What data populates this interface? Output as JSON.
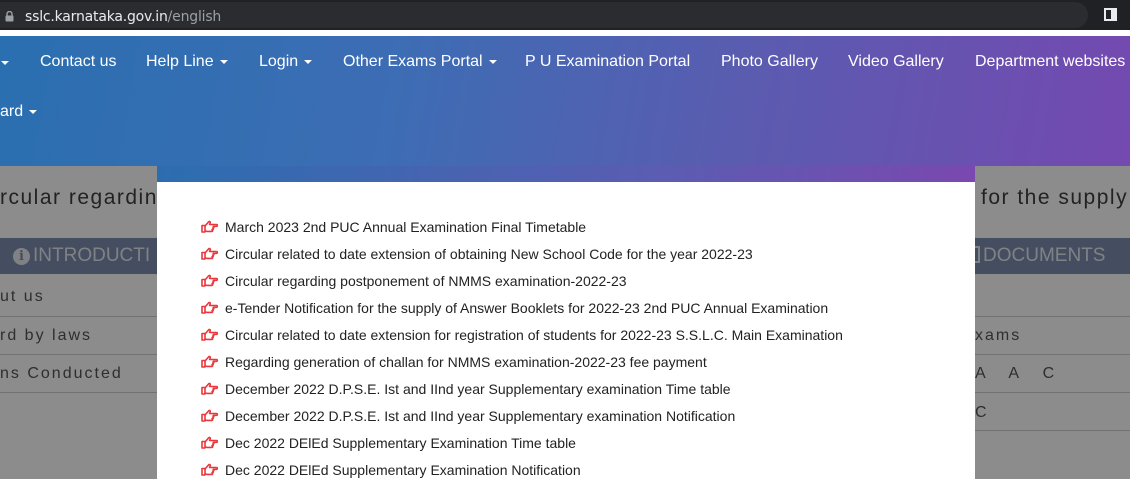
{
  "browser": {
    "url_domain": "sslc.karnataka.gov.in",
    "url_path": "/english"
  },
  "nav": {
    "items": [
      {
        "label": "Contact us",
        "dropdown": false
      },
      {
        "label": "Help Line",
        "dropdown": true
      },
      {
        "label": "Login",
        "dropdown": true
      },
      {
        "label": "Other Exams Portal",
        "dropdown": true
      },
      {
        "label": "P U Examination Portal",
        "dropdown": false
      },
      {
        "label": "Photo Gallery",
        "dropdown": false
      },
      {
        "label": "Video Gallery",
        "dropdown": false
      },
      {
        "label": "Department websites",
        "dropdown": false
      }
    ],
    "second_row_label": "ard"
  },
  "background": {
    "marquee_left": "rcular regardin",
    "marquee_right": "for the supply",
    "tab_introduction": "INTRODUCTI",
    "tab_documents": "DOCUMENTS",
    "left_rows": [
      "ut us",
      "rd by laws",
      "ns Conducted"
    ],
    "right_rows": [
      "xams",
      "A A C",
      "C"
    ]
  },
  "modal": {
    "items": [
      "March 2023 2nd PUC Annual Examination Final Timetable",
      "Circular related to date extension of obtaining New School Code for the year 2022-23",
      "Circular regarding postponement of NMMS examination-2022-23",
      "e-Tender Notification for the supply of Answer Booklets for 2022-23 2nd PUC Annual Examination",
      "Circular related to date extension for registration of students for 2022-23 S.S.L.C. Main Examination",
      "Regarding generation of challan for NMMS examination-2022-23 fee payment",
      "December 2022 D.P.S.E. Ist and IInd year Supplementary examination Time table",
      "December 2022 D.P.S.E. Ist and IInd year Supplementary examination Notification",
      "Dec 2022 DElEd Supplementary Examination Time table",
      "Dec 2022 DElEd Supplementary Examination Notification"
    ]
  },
  "colors": {
    "nav_gradient_start": "#2a6fb0",
    "nav_gradient_end": "#7449b0",
    "hand_icon": "#e8383d"
  },
  "icons": {
    "list_bullet": "hand-pointing-right-icon",
    "lock": "lock-icon",
    "sidebar": "sidebar-panel-icon",
    "info": "info-icon"
  }
}
